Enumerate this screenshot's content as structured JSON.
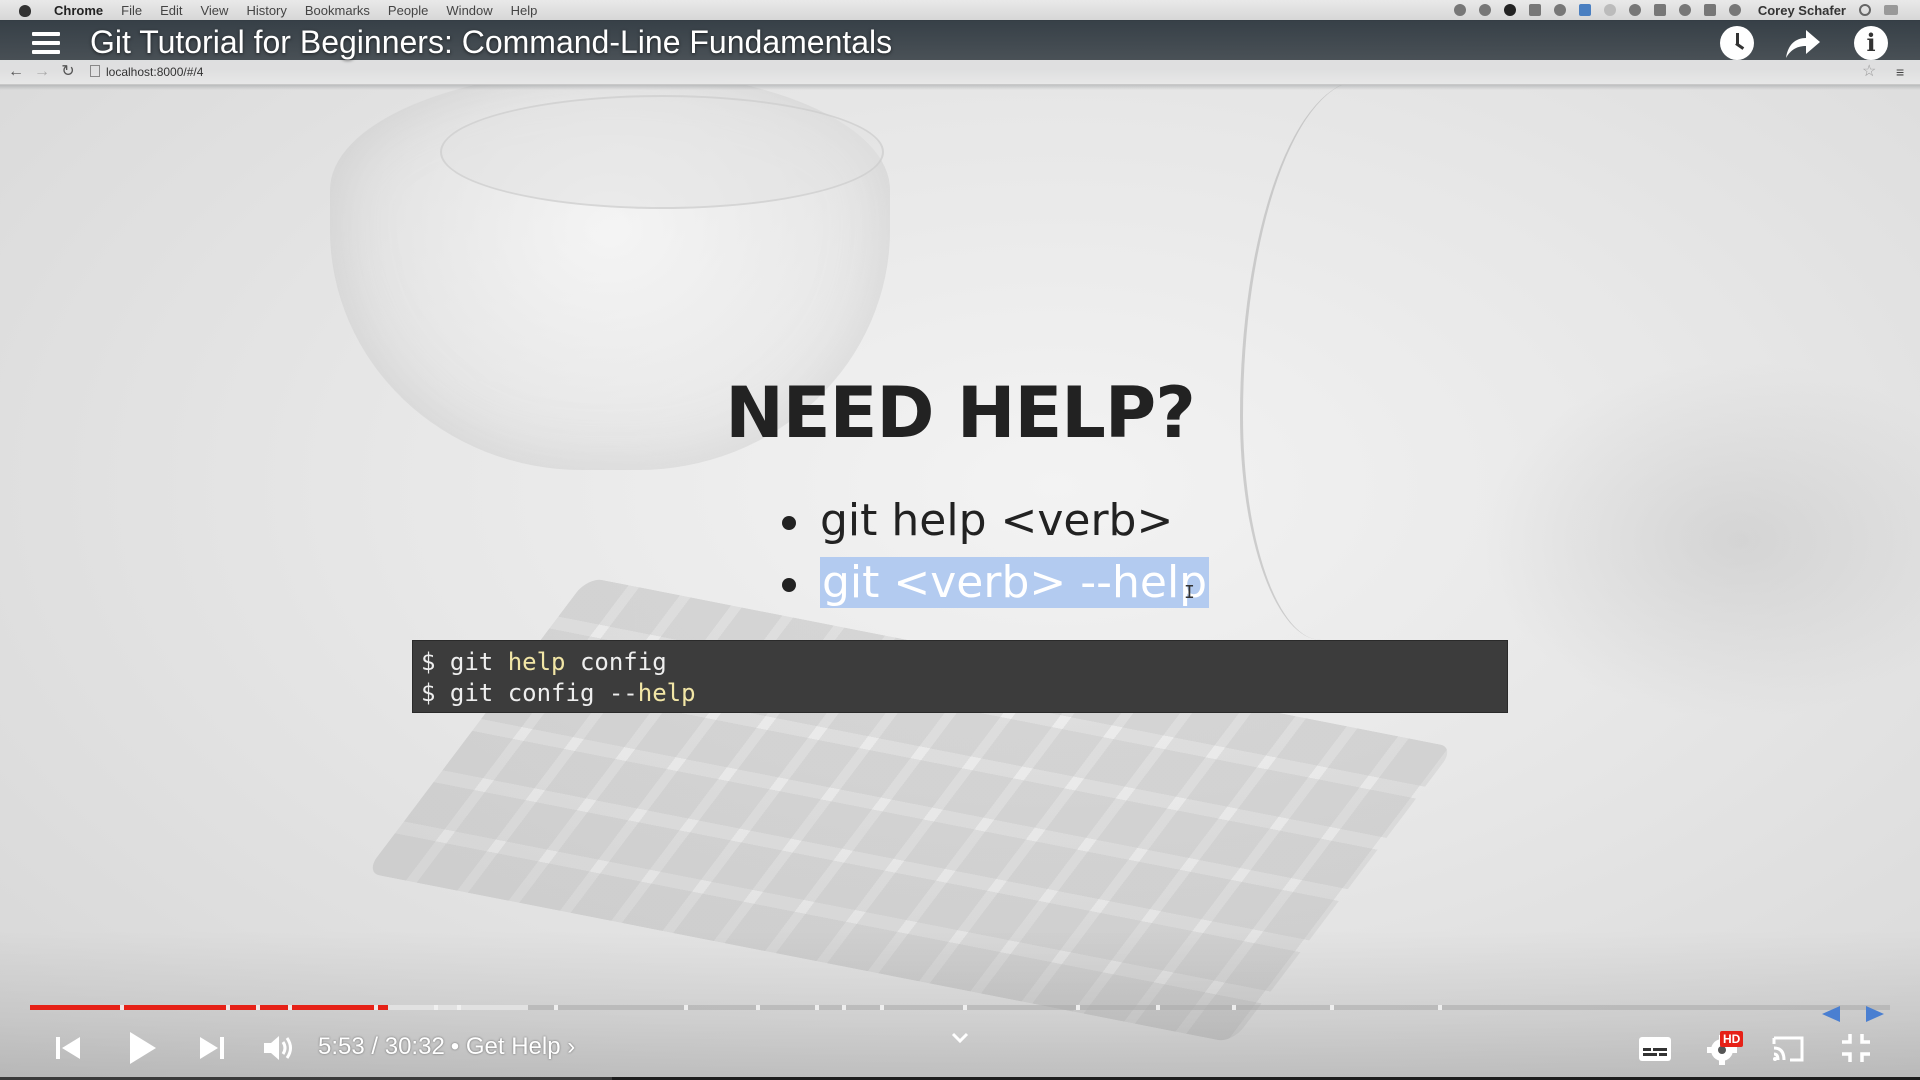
{
  "menubar": {
    "app": "Chrome",
    "items": [
      "File",
      "Edit",
      "View",
      "History",
      "Bookmarks",
      "People",
      "Window",
      "Help"
    ],
    "user": "Corey Schafer",
    "status_icons": [
      "record-icon",
      "notification-icon",
      "dark-circle-icon",
      "dropbox-icon",
      "drive-icon",
      "display-icon",
      "circle-icon",
      "time-machine-icon",
      "bluetooth-icon",
      "wifi-icon",
      "volume-icon",
      "clock-icon"
    ]
  },
  "browser": {
    "url": "localhost:8000/#/4"
  },
  "video": {
    "title": "Git Tutorial for Beginners: Command-Line Fundamentals"
  },
  "slide": {
    "heading": "NEED HELP?",
    "bullets": [
      "git help <verb>",
      "git <verb> --help"
    ],
    "selected_bullet_index": 1,
    "code_lines": [
      {
        "prefix": "$ git ",
        "keyword": "help",
        "suffix": " config"
      },
      {
        "prefix": "$ git config --",
        "keyword": "help",
        "suffix": ""
      }
    ]
  },
  "player": {
    "current_time": "5:53",
    "separator": " / ",
    "duration": "30:32",
    "chapter": "• Get Help ›",
    "played_fraction": 0.1927,
    "hd_badge": "HD",
    "colors": {
      "progress_played": "#e62117",
      "selection_highlight": "#b3cbf0",
      "code_background": "#3c3c3c",
      "code_keyword": "#f2e6a6"
    }
  }
}
